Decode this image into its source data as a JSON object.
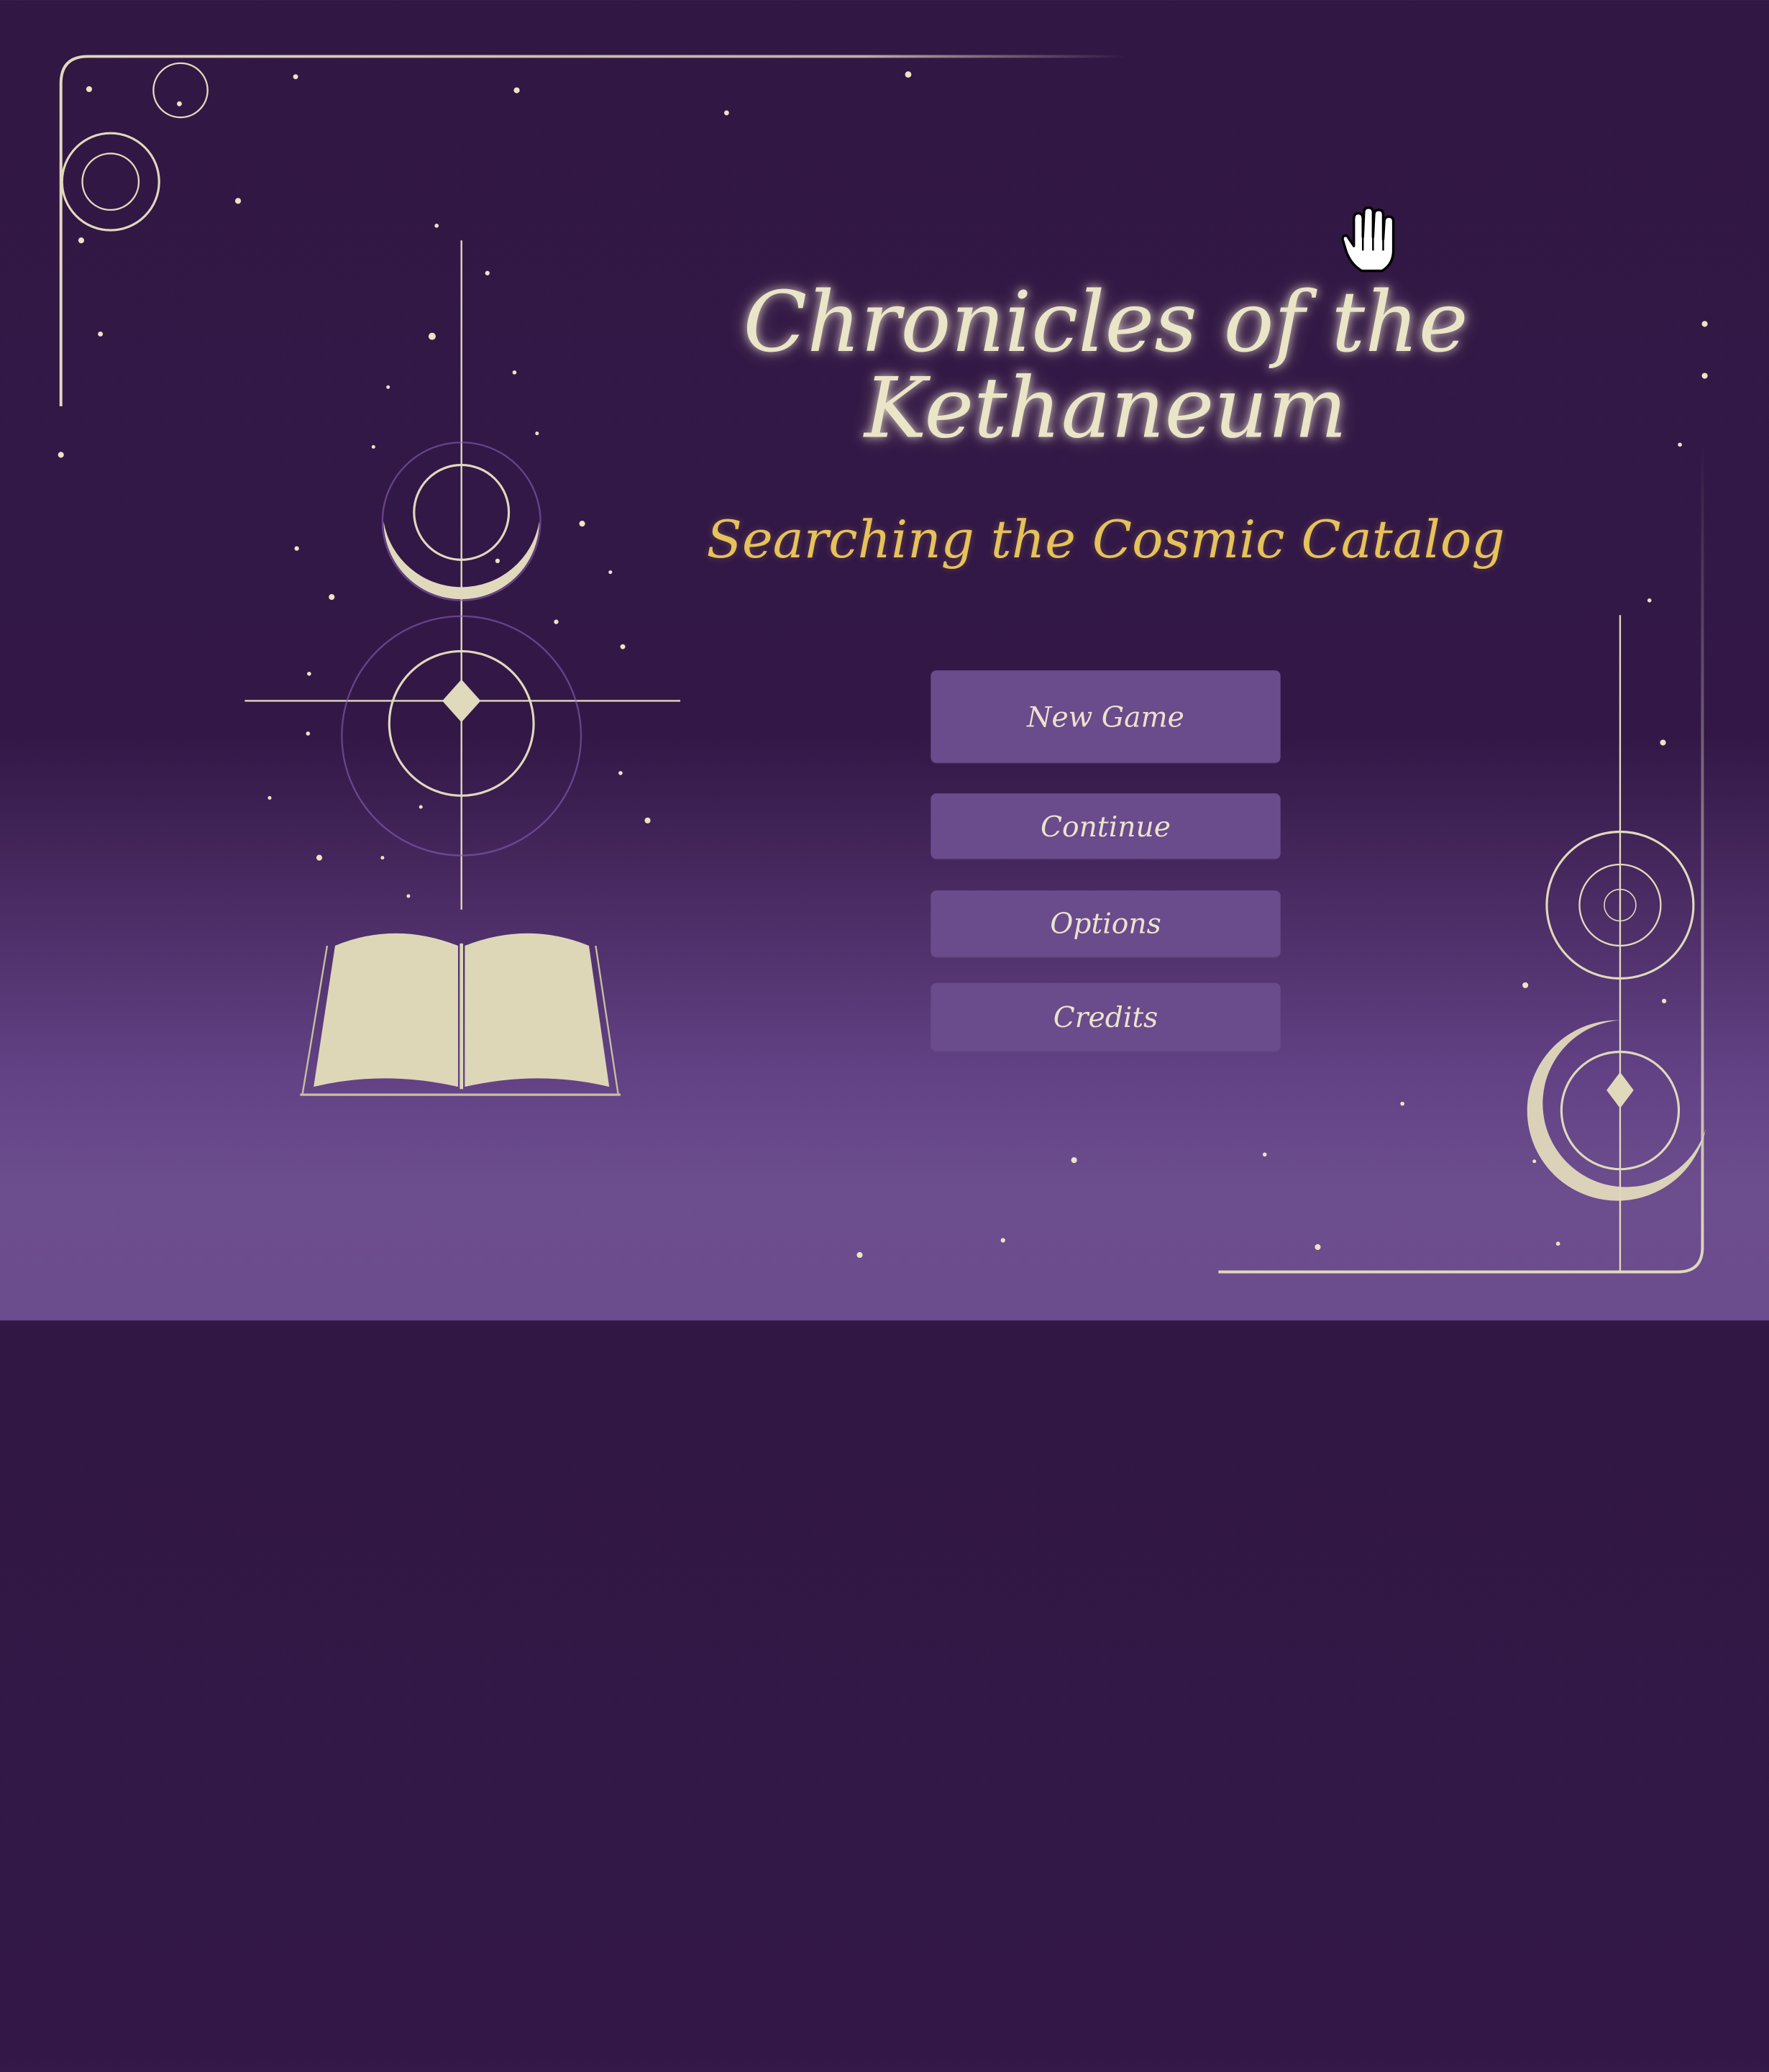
{
  "game": {
    "title_line1": "Chronicles of the",
    "title_line2": "Kethaneum",
    "subtitle": "Searching the Cosmic Catalog"
  },
  "menu": {
    "new_game": "New Game",
    "continue": "Continue",
    "options": "Options",
    "credits": "Credits"
  },
  "theme": {
    "background_top": "#311744",
    "background_bottom": "#6b4c8c",
    "ornament_color": "#e1d9bc",
    "title_color": "#ebe5c8",
    "subtitle_color": "#e6c25a",
    "button_color": "#6a4b8c"
  },
  "cursor": {
    "icon": "hand-cursor-icon"
  }
}
